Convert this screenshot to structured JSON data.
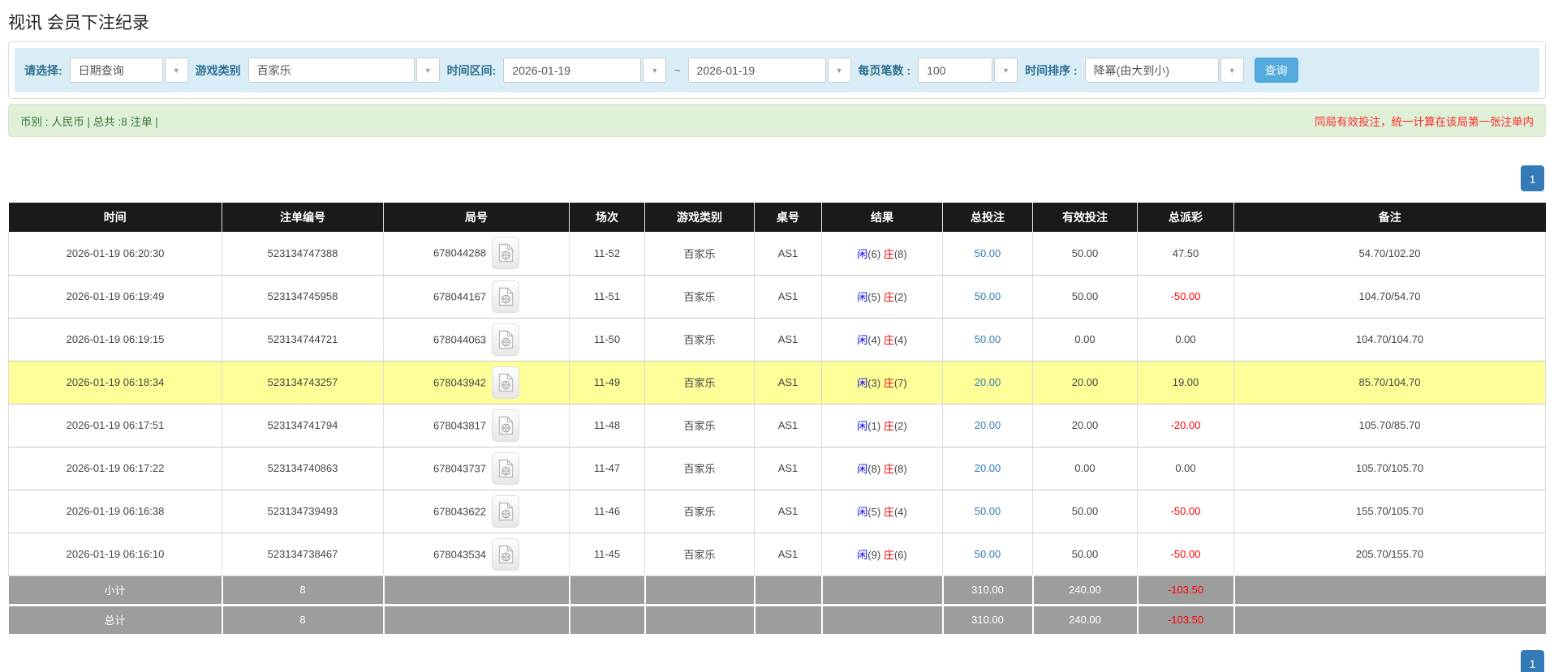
{
  "page_title": "视讯 会员下注纪录",
  "filter_bar": {
    "select_type": {
      "label": "请选择:",
      "value": "日期查询"
    },
    "game_category": {
      "label": "游戏类别",
      "value": "百家乐"
    },
    "time_range": {
      "label": "时间区间:",
      "from": "2026-01-19",
      "separator": "~",
      "to": "2026-01-19"
    },
    "page_size": {
      "label": "每页笔数 :",
      "value": "100"
    },
    "time_sort": {
      "label": "时间排序 :",
      "value": "降幂(由大到小)"
    },
    "search_button": "查询"
  },
  "summary_bar": {
    "left_text": "币别 : 人民币 | 总共 :8 注单 |",
    "right_text": "同局有效投注，统一计算在该局第一张注单内"
  },
  "pagination": {
    "current_page": "1"
  },
  "icons": {
    "row_icon": "video-file-icon",
    "dropdown_icon": "chevron-down-icon"
  },
  "colors": {
    "accent_blue": "#337ab7",
    "button_blue": "#53aadc",
    "filter_bar_bg": "#d9edf7",
    "summary_bg": "#dff0d8",
    "summary_text": "#3c763d",
    "warning_red": "#ff2a2a",
    "header_bg": "#1a1a1a",
    "highlight_yellow": "#ffff99",
    "footer_gray": "#9d9d9d",
    "player_blue": "#0000ee",
    "banker_red": "#ee0000",
    "negative_red": "#ff0000"
  },
  "table": {
    "columns": [
      "时间",
      "注单编号",
      "局号",
      "场次",
      "游戏类别",
      "桌号",
      "结果",
      "总投注",
      "有效投注",
      "总派彩",
      "备注"
    ],
    "rows": [
      {
        "time": "2026-01-19 06:20:30",
        "bet_id": "523134747388",
        "round_id": "678044288",
        "session": "11-52",
        "game": "百家乐",
        "table_no": "AS1",
        "result": {
          "player": "闲(6)",
          "banker": "庄(8)"
        },
        "total_bet": "50.00",
        "valid_bet": "50.00",
        "payout": "47.50",
        "remark": "54.70/102.20",
        "highlighted": false
      },
      {
        "time": "2026-01-19 06:19:49",
        "bet_id": "523134745958",
        "round_id": "678044167",
        "session": "11-51",
        "game": "百家乐",
        "table_no": "AS1",
        "result": {
          "player": "闲(5)",
          "banker": "庄(2)"
        },
        "total_bet": "50.00",
        "valid_bet": "50.00",
        "payout": "-50.00",
        "remark": "104.70/54.70",
        "highlighted": false
      },
      {
        "time": "2026-01-19 06:19:15",
        "bet_id": "523134744721",
        "round_id": "678044063",
        "session": "11-50",
        "game": "百家乐",
        "table_no": "AS1",
        "result": {
          "player": "闲(4)",
          "banker": "庄(4)"
        },
        "total_bet": "50.00",
        "valid_bet": "0.00",
        "payout": "0.00",
        "remark": "104.70/104.70",
        "highlighted": false
      },
      {
        "time": "2026-01-19 06:18:34",
        "bet_id": "523134743257",
        "round_id": "678043942",
        "session": "11-49",
        "game": "百家乐",
        "table_no": "AS1",
        "result": {
          "player": "闲(3)",
          "banker": "庄(7)"
        },
        "total_bet": "20.00",
        "valid_bet": "20.00",
        "payout": "19.00",
        "remark": "85.70/104.70",
        "highlighted": true
      },
      {
        "time": "2026-01-19 06:17:51",
        "bet_id": "523134741794",
        "round_id": "678043817",
        "session": "11-48",
        "game": "百家乐",
        "table_no": "AS1",
        "result": {
          "player": "闲(1)",
          "banker": "庄(2)"
        },
        "total_bet": "20.00",
        "valid_bet": "20.00",
        "payout": "-20.00",
        "remark": "105.70/85.70",
        "highlighted": false
      },
      {
        "time": "2026-01-19 06:17:22",
        "bet_id": "523134740863",
        "round_id": "678043737",
        "session": "11-47",
        "game": "百家乐",
        "table_no": "AS1",
        "result": {
          "player": "闲(8)",
          "banker": "庄(8)"
        },
        "total_bet": "20.00",
        "valid_bet": "0.00",
        "payout": "0.00",
        "remark": "105.70/105.70",
        "highlighted": false
      },
      {
        "time": "2026-01-19 06:16:38",
        "bet_id": "523134739493",
        "round_id": "678043622",
        "session": "11-46",
        "game": "百家乐",
        "table_no": "AS1",
        "result": {
          "player": "闲(5)",
          "banker": "庄(4)"
        },
        "total_bet": "50.00",
        "valid_bet": "50.00",
        "payout": "-50.00",
        "remark": "155.70/105.70",
        "highlighted": false
      },
      {
        "time": "2026-01-19 06:16:10",
        "bet_id": "523134738467",
        "round_id": "678043534",
        "session": "11-45",
        "game": "百家乐",
        "table_no": "AS1",
        "result": {
          "player": "闲(9)",
          "banker": "庄(6)"
        },
        "total_bet": "50.00",
        "valid_bet": "50.00",
        "payout": "-50.00",
        "remark": "205.70/155.70",
        "highlighted": false
      }
    ],
    "subtotal": {
      "label": "小计",
      "count": "8",
      "total_bet": "310.00",
      "valid_bet": "240.00",
      "payout": "-103.50"
    },
    "total": {
      "label": "总计",
      "count": "8",
      "total_bet": "310.00",
      "valid_bet": "240.00",
      "payout": "-103.50"
    }
  }
}
